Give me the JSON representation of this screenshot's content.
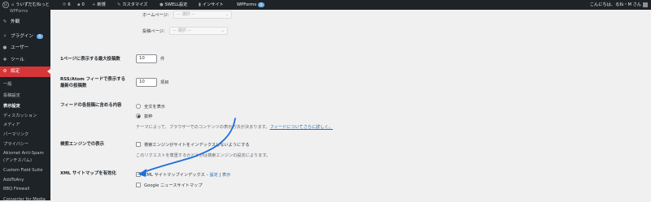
{
  "admin_bar": {
    "wp_logo": "wordpress-logo",
    "site_name": "ういずだむねっと",
    "updates_count": "6",
    "comments_count": "0",
    "new_label": "新規",
    "customize_label": "カスタマイズ",
    "swell_label": "SWELL設定",
    "insights_label": "インサイト",
    "wpforms_label": "WPForms",
    "wpforms_badge": "3",
    "greeting": "こんにちは、るね・M さん"
  },
  "sidebar": {
    "top_partial": "WPForms",
    "items": [
      {
        "label": "外観",
        "icon": "paintbrush-icon"
      },
      {
        "label": "プラグイン",
        "icon": "plugin-icon",
        "badge": "5"
      },
      {
        "label": "ユーザー",
        "icon": "user-icon"
      },
      {
        "label": "ツール",
        "icon": "wrench-icon"
      },
      {
        "label": "設定",
        "icon": "settings-icon"
      }
    ],
    "submenu": [
      "一般",
      "投稿設定",
      "表示設定",
      "ディスカッション",
      "メディア",
      "パーマリンク",
      "プライバシー",
      "Akismet Anti-Spam",
      "(アンチスパム)",
      "Custom Field Suite",
      "AddToAny",
      "BBQ Firewall",
      "Converter for Media"
    ]
  },
  "settings": {
    "homepage_label": "ホームページ:",
    "postspage_label": "投稿ページ:",
    "select_placeholder": "— 選択 —",
    "posts_per_page_label": "1ページに表示する最大投稿数",
    "posts_per_page_value": "10",
    "posts_per_page_unit": "件",
    "rss_label_1": "RSS/Atom フィードで表示する",
    "rss_label_2": "最新の投稿数",
    "rss_value": "10",
    "rss_unit": "項目",
    "feed_content_label": "フィードの各投稿に含める内容",
    "feed_option_full": "全文を表示",
    "feed_option_excerpt": "抜粋",
    "feed_desc_prefix": "テーマによって、ブラウザーでのコンテンツの表示方法が決まります。",
    "feed_desc_link": "フィードについてさらに詳しく。",
    "search_visibility_label": "検索エンジンでの表示",
    "search_visibility_option": "検索エンジンがサイトをインデックスしないようにする",
    "search_visibility_desc": "このリクエストを尊重するかどうかは検索エンジンの設定によります。",
    "xml_sitemap_label": "XML サイトマップを有効化",
    "xml_sitemap_index": "XML サイトマップインデックス",
    "xml_sitemap_sep": " – ",
    "xml_sitemap_settings": "設定",
    "xml_sitemap_bar": " | ",
    "xml_sitemap_view": "表示",
    "google_news_sitemap": "Google ニュースサイトマップ"
  }
}
